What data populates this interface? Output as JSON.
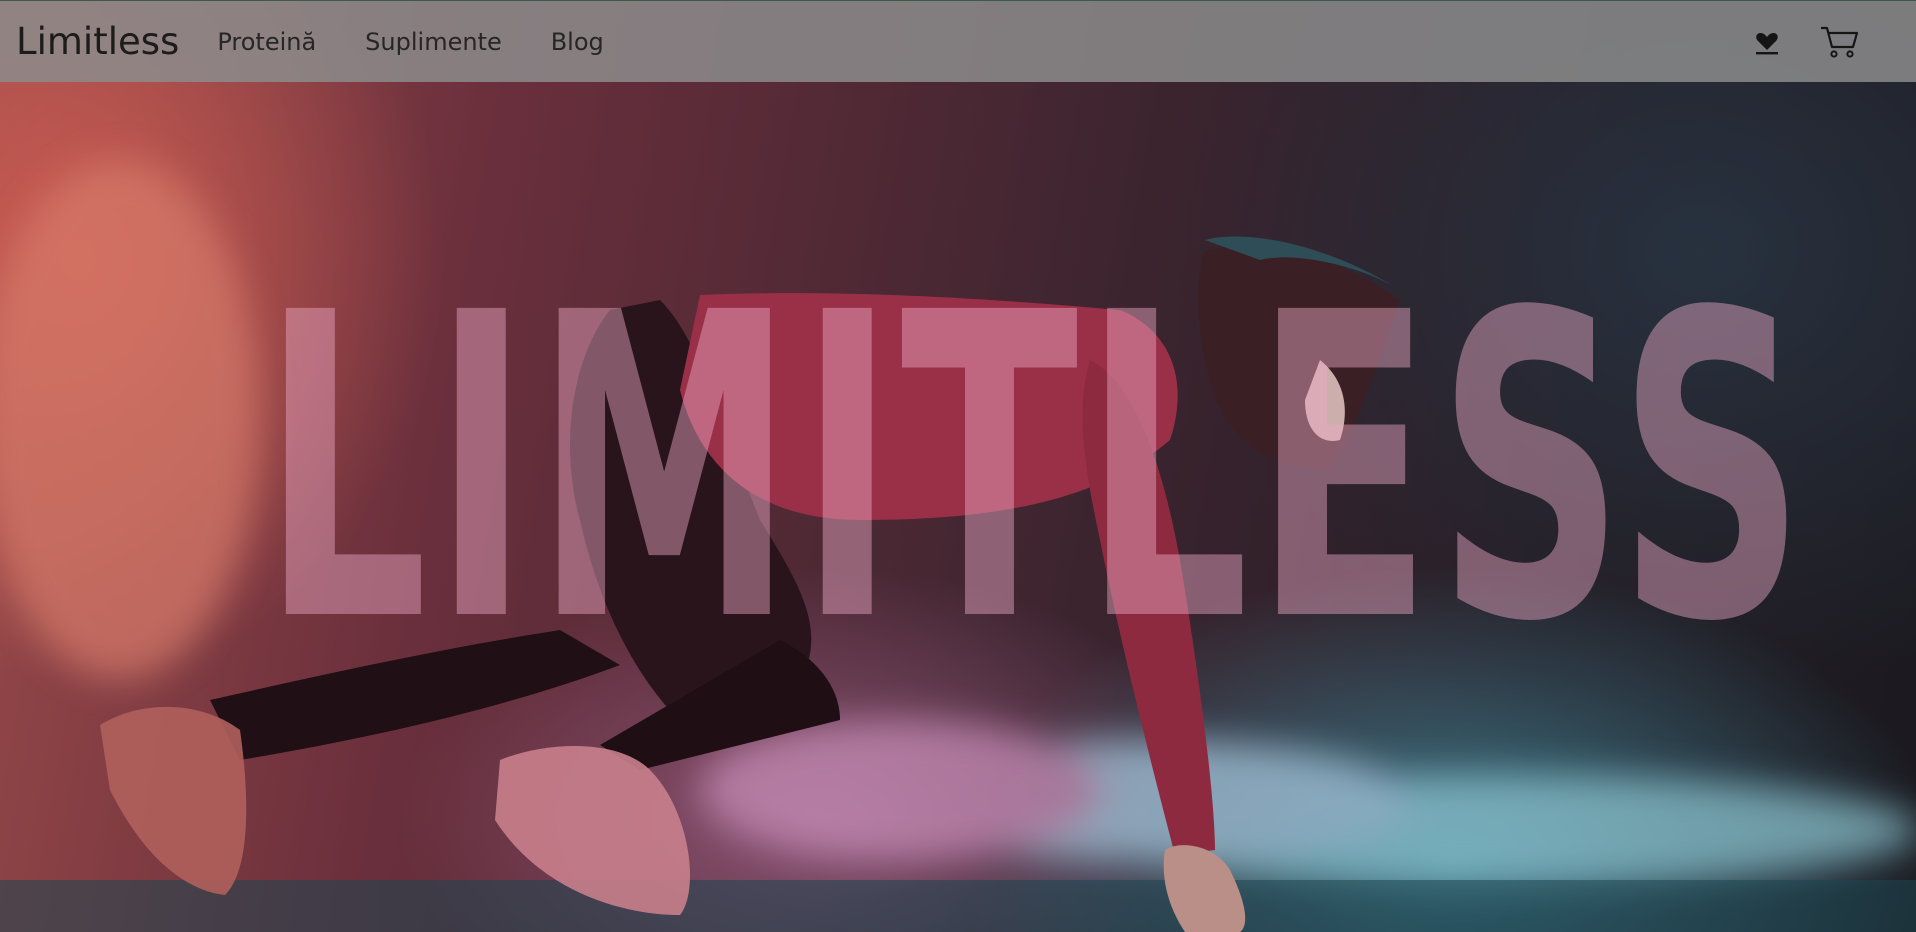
{
  "navbar": {
    "brand": "Limitless",
    "links": [
      {
        "label": "Proteină"
      },
      {
        "label": "Suplimente"
      },
      {
        "label": "Blog"
      }
    ],
    "icons": [
      "heart-icon",
      "cart-icon"
    ]
  },
  "hero": {
    "headline": "LIMITLESS",
    "image": "athlete in sprint start position with colored smoke"
  },
  "colors": {
    "navbar_bg": "#8c8c8c",
    "text_dark": "#1c1c1c",
    "smoke_warm": "#d66054",
    "smoke_cool": "#4696aa",
    "headline_tint": "#eeaac8"
  }
}
